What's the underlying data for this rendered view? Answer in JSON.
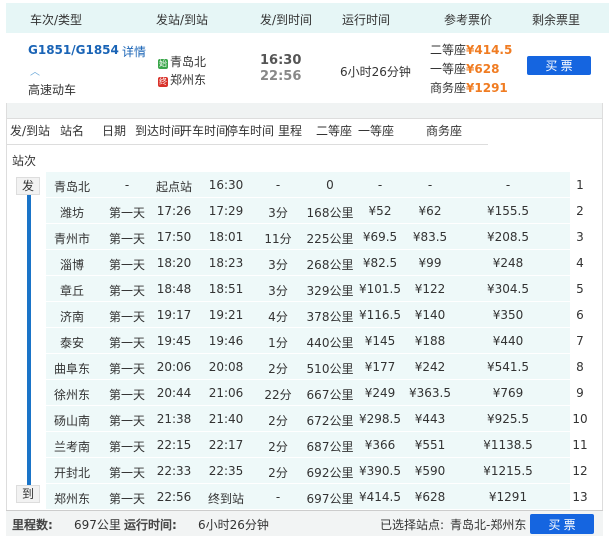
{
  "header": {
    "train": "车次/类型",
    "stations": "发站/到站",
    "times": "发/到时间",
    "duration": "运行时间",
    "price": "参考票价",
    "remaining": "剩余票里"
  },
  "train": {
    "number": "G1851/G1854",
    "detail": "详情",
    "type": "高速动车",
    "from_badge": "始",
    "from": "青岛北",
    "to_badge": "终",
    "to": "郑州东",
    "depart": "16:30",
    "arrive": "22:56",
    "duration": "6小时26分钟",
    "prices": [
      {
        "seat": "二等座",
        "price": "¥414.5"
      },
      {
        "seat": "一等座",
        "price": "¥628"
      },
      {
        "seat": "商务座",
        "price": "¥1291"
      }
    ],
    "buy": "买 票"
  },
  "stops_header": {
    "role": "发/到站",
    "station": "站名",
    "date": "日期",
    "arrive": "到达时间",
    "depart": "开车时间",
    "stop": "停车时间",
    "mileage": "里程",
    "second": "二等座",
    "first": "一等座",
    "business": "商务座",
    "index": "站次"
  },
  "tags": {
    "start": "发",
    "end": "到"
  },
  "stops": [
    [
      "青岛北",
      "-",
      "起点站",
      "16:30",
      "-",
      "0",
      "-",
      "-",
      "-",
      "1"
    ],
    [
      "潍坊",
      "第一天",
      "17:26",
      "17:29",
      "3分",
      "168公里",
      "¥52",
      "¥62",
      "¥155.5",
      "2"
    ],
    [
      "青州市",
      "第一天",
      "17:50",
      "18:01",
      "11分",
      "225公里",
      "¥69.5",
      "¥83.5",
      "¥208.5",
      "3"
    ],
    [
      "淄博",
      "第一天",
      "18:20",
      "18:23",
      "3分",
      "268公里",
      "¥82.5",
      "¥99",
      "¥248",
      "4"
    ],
    [
      "章丘",
      "第一天",
      "18:48",
      "18:51",
      "3分",
      "329公里",
      "¥101.5",
      "¥122",
      "¥304.5",
      "5"
    ],
    [
      "济南",
      "第一天",
      "19:17",
      "19:21",
      "4分",
      "378公里",
      "¥116.5",
      "¥140",
      "¥350",
      "6"
    ],
    [
      "泰安",
      "第一天",
      "19:45",
      "19:46",
      "1分",
      "440公里",
      "¥145",
      "¥188",
      "¥440",
      "7"
    ],
    [
      "曲阜东",
      "第一天",
      "20:06",
      "20:08",
      "2分",
      "510公里",
      "¥177",
      "¥242",
      "¥541.5",
      "8"
    ],
    [
      "徐州东",
      "第一天",
      "20:44",
      "21:06",
      "22分",
      "667公里",
      "¥249",
      "¥363.5",
      "¥769",
      "9"
    ],
    [
      "砀山南",
      "第一天",
      "21:38",
      "21:40",
      "2分",
      "672公里",
      "¥298.5",
      "¥443",
      "¥925.5",
      "10"
    ],
    [
      "兰考南",
      "第一天",
      "22:15",
      "22:17",
      "2分",
      "687公里",
      "¥366",
      "¥551",
      "¥1138.5",
      "11"
    ],
    [
      "开封北",
      "第一天",
      "22:33",
      "22:35",
      "2分",
      "692公里",
      "¥390.5",
      "¥590",
      "¥1215.5",
      "12"
    ],
    [
      "郑州东",
      "第一天",
      "22:56",
      "终到站",
      "-",
      "697公里",
      "¥414.5",
      "¥628",
      "¥1291",
      "13"
    ]
  ],
  "footer": {
    "mileage_label": "里程数:",
    "mileage": "697公里",
    "time_label": "运行时间:",
    "time": "6小时26分钟",
    "selected_label": "已选择站点:",
    "selected": "青岛北-郑州东",
    "buy": "买 票"
  }
}
